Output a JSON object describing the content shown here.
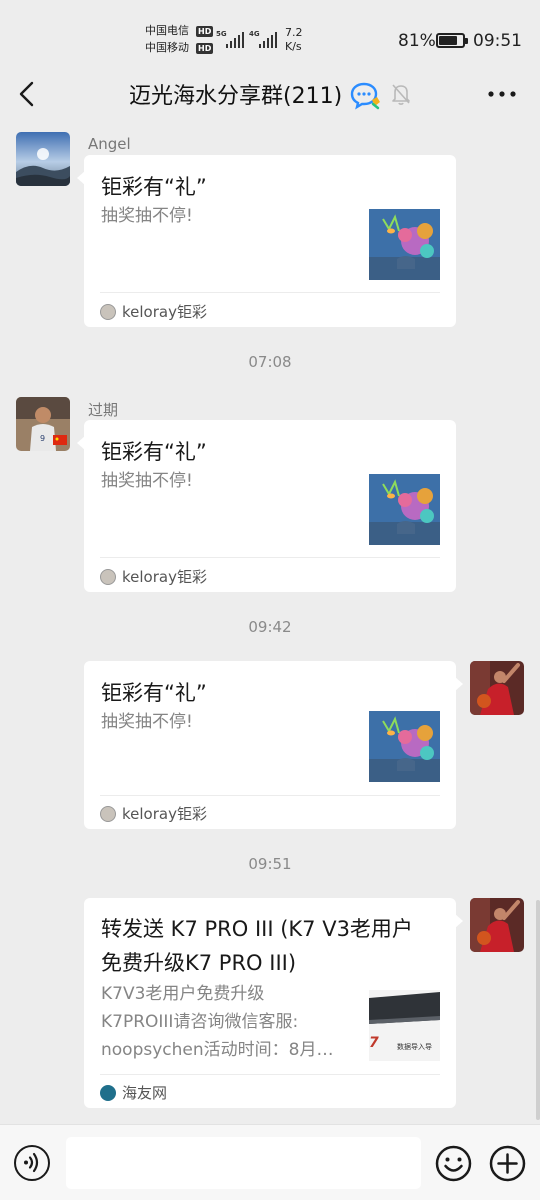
{
  "status_bar": {
    "carrier1": "中国电信",
    "carrier2": "中国移动",
    "hd_badge": "HD",
    "signal1_label": "5G",
    "signal2_label": "4G",
    "net_speed_value": "7.2",
    "net_speed_unit": "K/s",
    "battery_percent": "81%",
    "battery_level": 0.81,
    "time": "09:51"
  },
  "header": {
    "title": "迈光海水分享群(211)",
    "back_icon": "back-chevron-icon",
    "chat_icon": "group-chat-icon",
    "mute_icon": "mute-bell-icon",
    "more_icon": "more-dots-icon"
  },
  "messages": [
    {
      "sender": "Angel",
      "side": "left",
      "card": {
        "title": "钜彩有“礼”",
        "desc": "抽奖抽不停!",
        "source": "keloray钜彩"
      }
    },
    {
      "timestamp": "07:08"
    },
    {
      "sender": "过期",
      "side": "left",
      "card": {
        "title": "钜彩有“礼”",
        "desc": "抽奖抽不停!",
        "source": "keloray钜彩"
      }
    },
    {
      "timestamp": "09:42"
    },
    {
      "side": "right",
      "card": {
        "title": "钜彩有“礼”",
        "desc": "抽奖抽不停!",
        "source": "keloray钜彩"
      }
    },
    {
      "timestamp": "09:51"
    },
    {
      "side": "right",
      "card": {
        "title_line1": "转发送 K7 PRO III (K7 V3老用户",
        "title_line2": "免费升级K7 PRO III)",
        "desc_line1": "K7V3老用户免费升级",
        "desc_line2": "K7PROIII请咨询微信客服:",
        "desc_line3": "noopsychen活动时间：8月…",
        "thumb_text": "7",
        "thumb_caption": "数据导入导",
        "source": "海友网"
      }
    }
  ],
  "input_bar": {
    "voice_icon": "voice-icon",
    "emoji_icon": "emoji-icon",
    "plus_icon": "plus-icon"
  },
  "colors": {
    "background": "#ededed",
    "bubble": "#ffffff",
    "muted_text": "#858585",
    "timestamp": "#8a8a8a"
  }
}
